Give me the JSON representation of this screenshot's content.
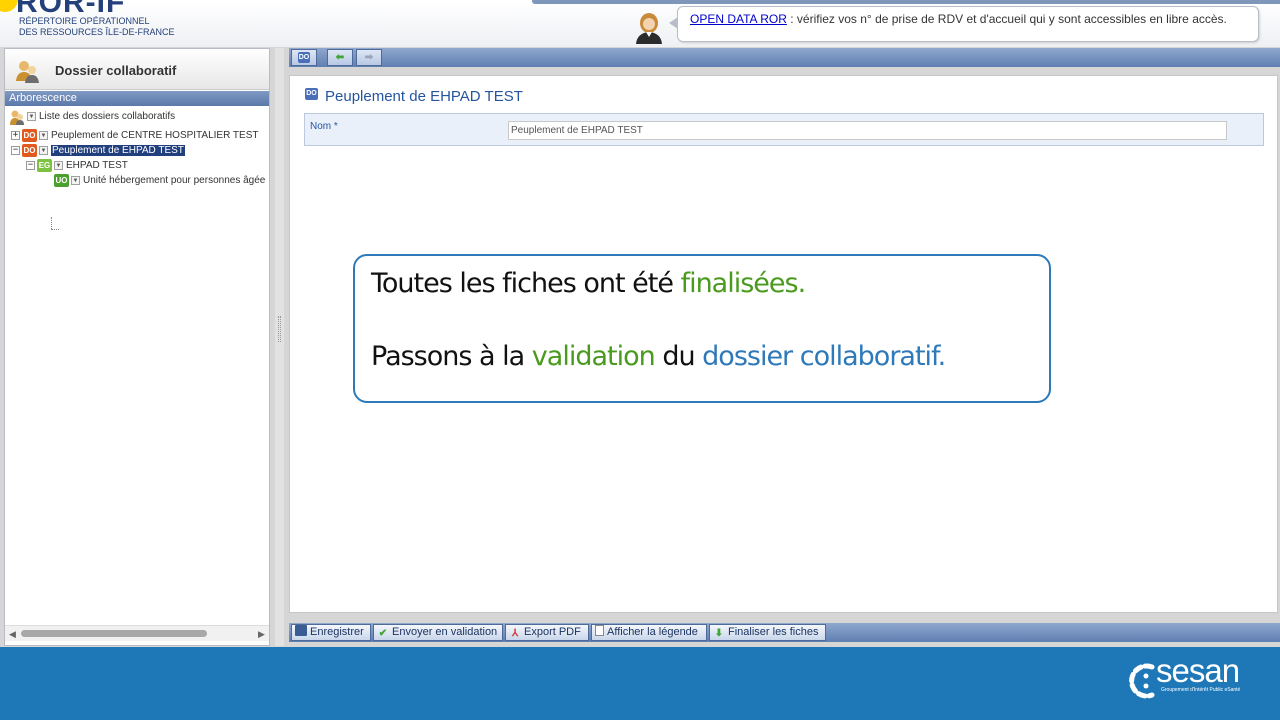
{
  "header": {
    "logo_main": "ROR-IF",
    "logo_sub_line1": "RÉPERTOIRE OPÉRATIONNEL",
    "logo_sub_line2": "DES RESSOURCES ÎLE-DE-FRANCE",
    "news_link": "OPEN DATA ROR",
    "news_text": " : vérifiez vos n° de prise de RDV et d'accueil qui y sont accessibles en libre accès."
  },
  "left_panel": {
    "title": "Dossier collaboratif",
    "section": "Arborescence",
    "tree": [
      {
        "label": "Liste des dossiers collaboratifs",
        "badge": ""
      },
      {
        "label": "Peuplement de CENTRE HOSPITALIER TEST",
        "badge": "DO",
        "expander": "+"
      },
      {
        "label": "Peuplement de EHPAD TEST",
        "badge": "DO",
        "expander": "−",
        "selected": true
      },
      {
        "label": "EHPAD TEST",
        "badge": "EG",
        "expander": "−"
      },
      {
        "label": "Unité hébergement pour personnes âgée",
        "badge": "UO"
      }
    ]
  },
  "toolbar": {
    "do_badge": "DO",
    "back_icon": "arrow-left-icon",
    "forward_icon": "arrow-right-icon"
  },
  "main": {
    "badge": "DO",
    "title": "Peuplement de EHPAD TEST",
    "name_label": "Nom *",
    "name_value": "Peuplement de EHPAD TEST"
  },
  "callout": {
    "line1_prefix": "Toutes les fiches ont été ",
    "line1_highlight": "finalisées.",
    "line2_prefix": "Passons à la ",
    "line2_highlight1": "validation",
    "line2_middle": " du ",
    "line2_highlight2": "dossier collaboratif."
  },
  "actions": {
    "save": "Enregistrer",
    "send": "Envoyer en validation",
    "pdf": "Export PDF",
    "legend": "Afficher la légende",
    "finalize": "Finaliser les fiches"
  },
  "footer": {
    "brand": "sesan",
    "tagline": "Groupement d'Intérêt Public eSanté"
  },
  "colors": {
    "accent_blue": "#2e79ba",
    "highlight_green": "#4a9a1e",
    "footer_blue": "#1e78b8",
    "selected_node": "#213f7d"
  }
}
